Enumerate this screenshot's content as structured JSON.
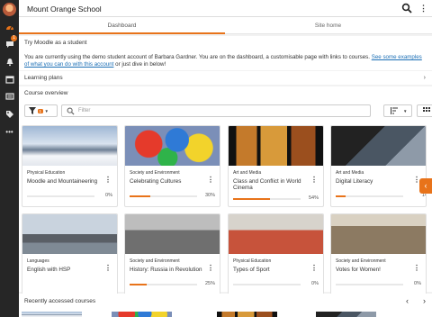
{
  "header": {
    "site_name": "Mount Orange School"
  },
  "rail": {
    "icons": [
      "dashboard-icon",
      "messages-icon",
      "notifications-icon",
      "calendar-icon",
      "files-icon",
      "badges-icon",
      "more-icon"
    ],
    "messages_badge": "1"
  },
  "tabs": {
    "dashboard": "Dashboard",
    "site_home": "Site home"
  },
  "try_moodle": {
    "heading": "Try Moodle as a student",
    "text": "You are currently using the demo student account of Barbara Gardner. You are on the dashboard, a customisable page with links to courses.",
    "link": "See some examples of what you can do with this account",
    "tail": "or just dive in below!"
  },
  "learning_plans": {
    "heading": "Learning plans"
  },
  "course_overview": {
    "heading": "Course overview",
    "filter_count": "1",
    "search_placeholder": "Filter",
    "courses": [
      {
        "category": "Physical Education",
        "title": "Moodle and Mountaineering",
        "progress": 0,
        "progress_label": "0%"
      },
      {
        "category": "Society and Environment",
        "title": "Celebrating Cultures",
        "progress": 30,
        "progress_label": "30%"
      },
      {
        "category": "Art and Media",
        "title": "Class and Conflict in World Cinema",
        "progress": 54,
        "progress_label": "54%"
      },
      {
        "category": "Art and Media",
        "title": "Digital Literacy",
        "progress": 14,
        "progress_label": "14"
      },
      {
        "category": "Languages",
        "title": "English with HSP",
        "progress": null,
        "progress_label": ""
      },
      {
        "category": "Society and Environment",
        "title": "History: Russia in Revolution",
        "progress": 25,
        "progress_label": "25%"
      },
      {
        "category": "Physical Education",
        "title": "Types of Sport",
        "progress": 0,
        "progress_label": "0%"
      },
      {
        "category": "Society and Environment",
        "title": "Votes for Women!",
        "progress": 0,
        "progress_label": "0%"
      }
    ]
  },
  "recent": {
    "heading": "Recently accessed courses"
  },
  "colors": {
    "accent": "#e8731a",
    "link": "#1a6eb5",
    "rail": "#262626"
  }
}
